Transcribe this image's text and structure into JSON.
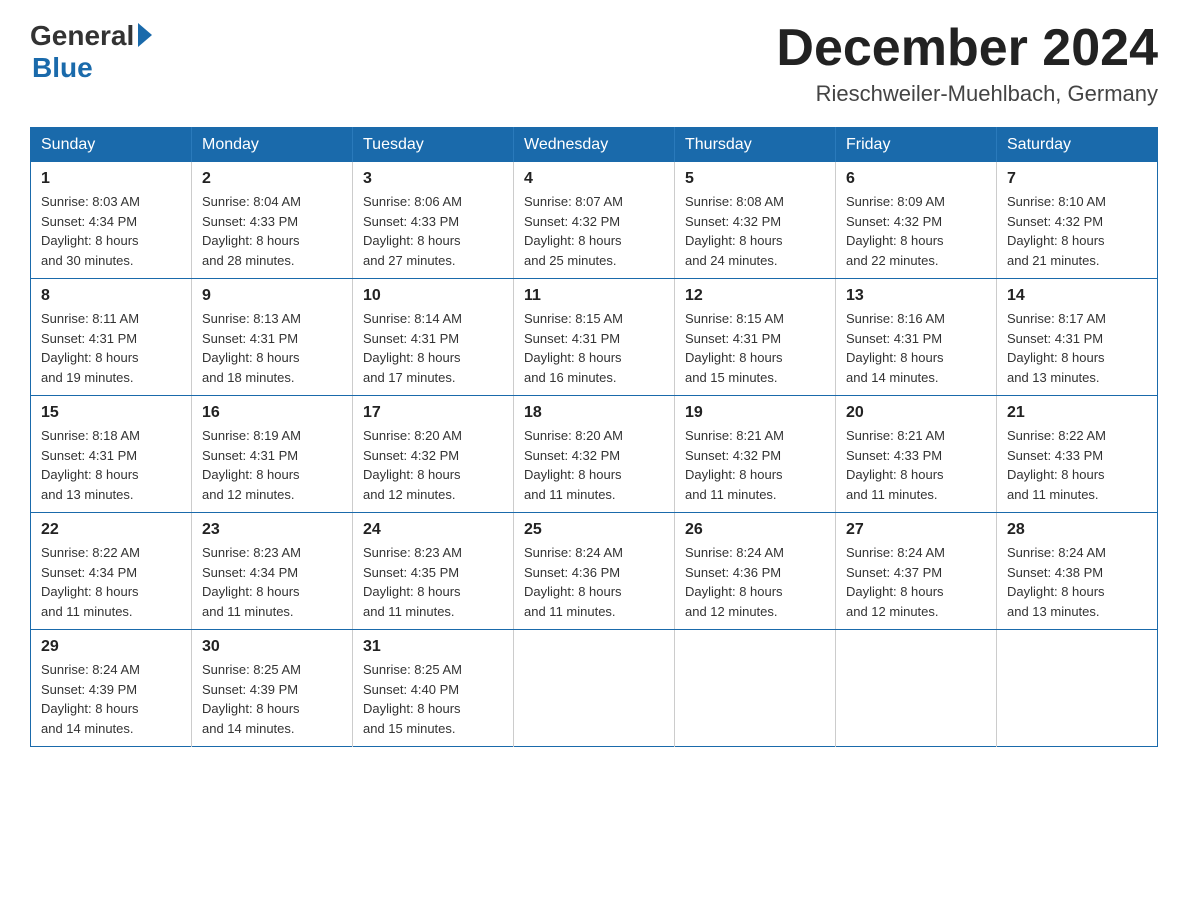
{
  "logo": {
    "general": "General",
    "blue": "Blue"
  },
  "title": "December 2024",
  "location": "Rieschweiler-Muehlbach, Germany",
  "weekdays": [
    "Sunday",
    "Monday",
    "Tuesday",
    "Wednesday",
    "Thursday",
    "Friday",
    "Saturday"
  ],
  "weeks": [
    [
      {
        "day": "1",
        "sunrise": "8:03 AM",
        "sunset": "4:34 PM",
        "daylight": "8 hours and 30 minutes."
      },
      {
        "day": "2",
        "sunrise": "8:04 AM",
        "sunset": "4:33 PM",
        "daylight": "8 hours and 28 minutes."
      },
      {
        "day": "3",
        "sunrise": "8:06 AM",
        "sunset": "4:33 PM",
        "daylight": "8 hours and 27 minutes."
      },
      {
        "day": "4",
        "sunrise": "8:07 AM",
        "sunset": "4:32 PM",
        "daylight": "8 hours and 25 minutes."
      },
      {
        "day": "5",
        "sunrise": "8:08 AM",
        "sunset": "4:32 PM",
        "daylight": "8 hours and 24 minutes."
      },
      {
        "day": "6",
        "sunrise": "8:09 AM",
        "sunset": "4:32 PM",
        "daylight": "8 hours and 22 minutes."
      },
      {
        "day": "7",
        "sunrise": "8:10 AM",
        "sunset": "4:32 PM",
        "daylight": "8 hours and 21 minutes."
      }
    ],
    [
      {
        "day": "8",
        "sunrise": "8:11 AM",
        "sunset": "4:31 PM",
        "daylight": "8 hours and 19 minutes."
      },
      {
        "day": "9",
        "sunrise": "8:13 AM",
        "sunset": "4:31 PM",
        "daylight": "8 hours and 18 minutes."
      },
      {
        "day": "10",
        "sunrise": "8:14 AM",
        "sunset": "4:31 PM",
        "daylight": "8 hours and 17 minutes."
      },
      {
        "day": "11",
        "sunrise": "8:15 AM",
        "sunset": "4:31 PM",
        "daylight": "8 hours and 16 minutes."
      },
      {
        "day": "12",
        "sunrise": "8:15 AM",
        "sunset": "4:31 PM",
        "daylight": "8 hours and 15 minutes."
      },
      {
        "day": "13",
        "sunrise": "8:16 AM",
        "sunset": "4:31 PM",
        "daylight": "8 hours and 14 minutes."
      },
      {
        "day": "14",
        "sunrise": "8:17 AM",
        "sunset": "4:31 PM",
        "daylight": "8 hours and 13 minutes."
      }
    ],
    [
      {
        "day": "15",
        "sunrise": "8:18 AM",
        "sunset": "4:31 PM",
        "daylight": "8 hours and 13 minutes."
      },
      {
        "day": "16",
        "sunrise": "8:19 AM",
        "sunset": "4:31 PM",
        "daylight": "8 hours and 12 minutes."
      },
      {
        "day": "17",
        "sunrise": "8:20 AM",
        "sunset": "4:32 PM",
        "daylight": "8 hours and 12 minutes."
      },
      {
        "day": "18",
        "sunrise": "8:20 AM",
        "sunset": "4:32 PM",
        "daylight": "8 hours and 11 minutes."
      },
      {
        "day": "19",
        "sunrise": "8:21 AM",
        "sunset": "4:32 PM",
        "daylight": "8 hours and 11 minutes."
      },
      {
        "day": "20",
        "sunrise": "8:21 AM",
        "sunset": "4:33 PM",
        "daylight": "8 hours and 11 minutes."
      },
      {
        "day": "21",
        "sunrise": "8:22 AM",
        "sunset": "4:33 PM",
        "daylight": "8 hours and 11 minutes."
      }
    ],
    [
      {
        "day": "22",
        "sunrise": "8:22 AM",
        "sunset": "4:34 PM",
        "daylight": "8 hours and 11 minutes."
      },
      {
        "day": "23",
        "sunrise": "8:23 AM",
        "sunset": "4:34 PM",
        "daylight": "8 hours and 11 minutes."
      },
      {
        "day": "24",
        "sunrise": "8:23 AM",
        "sunset": "4:35 PM",
        "daylight": "8 hours and 11 minutes."
      },
      {
        "day": "25",
        "sunrise": "8:24 AM",
        "sunset": "4:36 PM",
        "daylight": "8 hours and 11 minutes."
      },
      {
        "day": "26",
        "sunrise": "8:24 AM",
        "sunset": "4:36 PM",
        "daylight": "8 hours and 12 minutes."
      },
      {
        "day": "27",
        "sunrise": "8:24 AM",
        "sunset": "4:37 PM",
        "daylight": "8 hours and 12 minutes."
      },
      {
        "day": "28",
        "sunrise": "8:24 AM",
        "sunset": "4:38 PM",
        "daylight": "8 hours and 13 minutes."
      }
    ],
    [
      {
        "day": "29",
        "sunrise": "8:24 AM",
        "sunset": "4:39 PM",
        "daylight": "8 hours and 14 minutes."
      },
      {
        "day": "30",
        "sunrise": "8:25 AM",
        "sunset": "4:39 PM",
        "daylight": "8 hours and 14 minutes."
      },
      {
        "day": "31",
        "sunrise": "8:25 AM",
        "sunset": "4:40 PM",
        "daylight": "8 hours and 15 minutes."
      },
      null,
      null,
      null,
      null
    ]
  ],
  "labels": {
    "sunrise": "Sunrise:",
    "sunset": "Sunset:",
    "daylight": "Daylight:"
  }
}
